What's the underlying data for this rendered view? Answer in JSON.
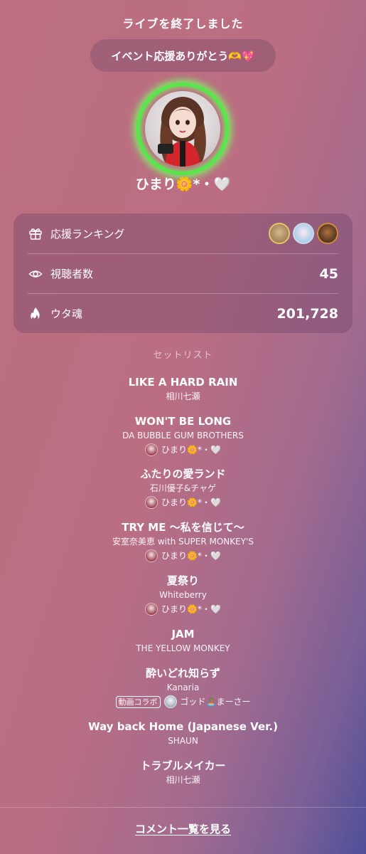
{
  "header": {
    "title": "ライブを終了しました"
  },
  "thanks_message": "イベント応援ありがとう🫶💖",
  "profile": {
    "avatar_icon": "user-avatar-icon",
    "username": "ひまり🌼*・🤍",
    "ring_color": "#56e84a"
  },
  "stats": {
    "ranking_label": "応援ランキング",
    "ranking_icon": "gift-icon",
    "viewers_label": "視聴者数",
    "viewers_icon": "eye-icon",
    "viewers_value": "45",
    "uta_label": "ウタ魂",
    "uta_icon": "flame-icon",
    "uta_value": "201,728"
  },
  "setlist": {
    "heading": "セットリスト",
    "songs": [
      {
        "title": "LIKE A HARD RAIN",
        "artist": "相川七瀬"
      },
      {
        "title": "WON'T BE LONG",
        "artist": "DA BUBBLE GUM BROTHERS",
        "singer": "ひまり🌼*・🤍"
      },
      {
        "title": "ふたりの愛ランド",
        "artist": "石川優子&チャゲ",
        "singer": "ひまり🌼*・🤍"
      },
      {
        "title": "TRY ME ～私を信じて～",
        "artist": "安室奈美恵 with SUPER MONKEY'S",
        "singer": "ひまり🌼*・🤍"
      },
      {
        "title": "夏祭り",
        "artist": "Whiteberry",
        "singer": "ひまり🌼*・🤍"
      },
      {
        "title": "JAM",
        "artist": "THE YELLOW MONKEY"
      },
      {
        "title": "酔いどれ知らず",
        "artist": "Kanaria",
        "collab_tag": "動画コラボ",
        "singer": "ゴッド🏝️まーさー"
      },
      {
        "title": "Way back Home (Japanese Ver.)",
        "artist": "SHAUN"
      },
      {
        "title": "トラブルメイカー",
        "artist": "相川七瀬"
      }
    ]
  },
  "footer": {
    "comment_link": "コメント一覧を見る"
  }
}
